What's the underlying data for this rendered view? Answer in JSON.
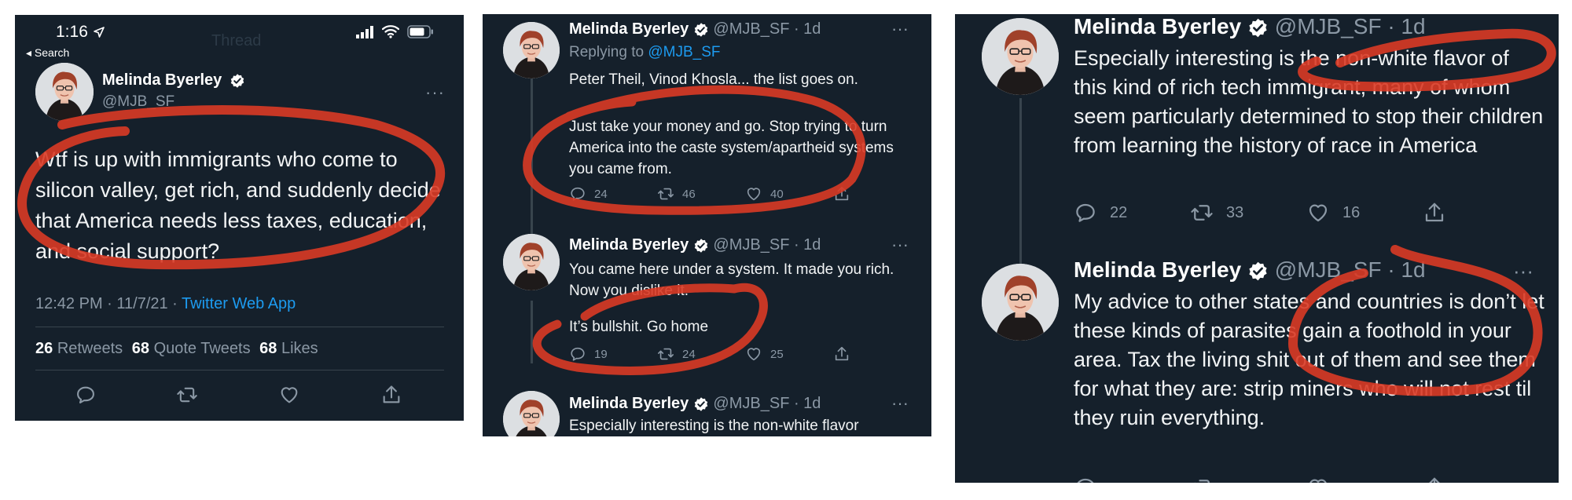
{
  "colors": {
    "background": "#15202b",
    "text": "#e7e9ea",
    "muted": "#8b98a5",
    "link": "#1d9bf0",
    "annotation": "#d93a25"
  },
  "panel1": {
    "status_time": "1:16",
    "back_label": "◂ Search",
    "header_faint": "Thread",
    "author": "Melinda Byerley",
    "handle": "@MJB_SF",
    "tweet": "Wtf is up with immigrants who come to silicon valley, get rich, and suddenly decide that America needs less taxes, education, and social support?",
    "meta_time": "12:42 PM · 11/7/21 · ",
    "meta_app": "Twitter Web App",
    "retweets_count": "26",
    "retweets_label": "Retweets",
    "quotes_count": "68",
    "quotes_label": "Quote Tweets",
    "likes_count": "68",
    "likes_label": "Likes"
  },
  "panel2": {
    "tweets": [
      {
        "author": "Melinda Byerley",
        "handle": "@MJB_SF · 1d",
        "replying_prefix": "Replying to ",
        "replying_handle": "@MJB_SF",
        "line1": "Peter Theil, Vinod Khosla... the list goes on.",
        "line2": "Just take your money and go. Stop trying to turn America into the caste system/apartheid systems you came from.",
        "replies": "24",
        "retweets": "46",
        "likes": "40"
      },
      {
        "author": "Melinda Byerley",
        "handle": "@MJB_SF · 1d",
        "line1": "You came here under a system. It made you rich. Now you dislike it.",
        "line2": "It’s bullshit. Go home",
        "replies": "19",
        "retweets": "24",
        "likes": "25"
      },
      {
        "author": "Melinda Byerley",
        "handle": "@MJB_SF · 1d",
        "line1": "Especially interesting is the non-white flavor"
      }
    ]
  },
  "panel3": {
    "tweets": [
      {
        "author": "Melinda Byerley",
        "handle": "@MJB_SF · 1d",
        "text": "Especially interesting is the non-white flavor of this kind of rich tech immigrant, many of whom seem particularly determined to stop their children from learning the history of race in America",
        "replies": "22",
        "retweets": "33",
        "likes": "16"
      },
      {
        "author": "Melinda Byerley",
        "handle": "@MJB_SF · 1d",
        "text": "My advice to other states and countries is don’t let these kinds of parasites gain a foothold in your area. Tax the living shit out of them and see them for what they are: strip miners who will not rest til they ruin everything."
      }
    ]
  }
}
